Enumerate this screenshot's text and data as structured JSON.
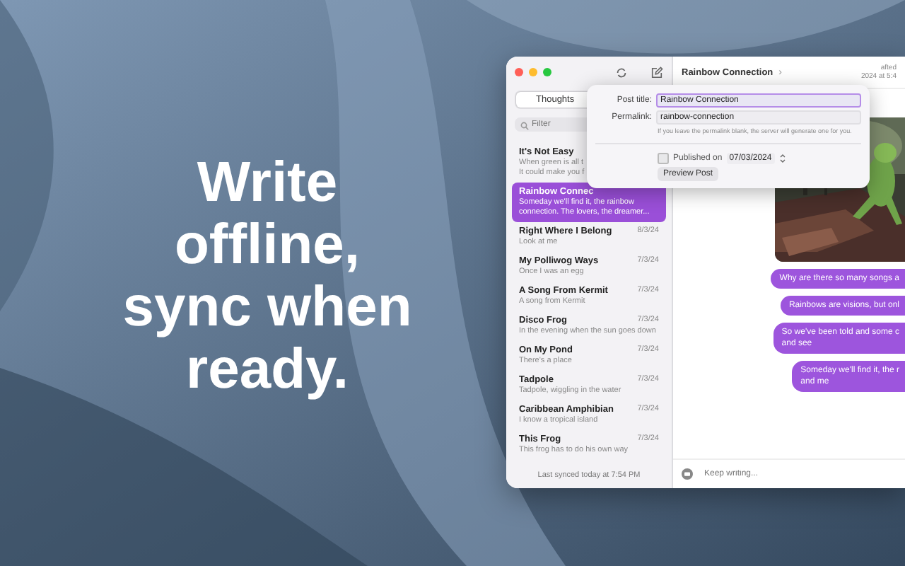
{
  "headline": "Write\noffline,\nsync when\nready.",
  "sidebar": {
    "tabs": [
      {
        "label": "Thoughts",
        "selected": true
      }
    ],
    "search": {
      "placeholder": "Filter"
    },
    "items": [
      {
        "title": "It's Not Easy",
        "preview": "When green is all t\nIt could make you f",
        "selected": false
      },
      {
        "title": "Rainbow Connec",
        "preview": "Someday we'll find it, the rainbow connection. The lovers, the dreamer...",
        "selected": true
      },
      {
        "title": "Right Where I Belong",
        "preview": "Look at me",
        "date": "8/3/24",
        "selected": false
      },
      {
        "title": "My Polliwog Ways",
        "preview": "Once I was an egg",
        "date": "7/3/24",
        "selected": false
      },
      {
        "title": "A Song From Kermit",
        "preview": "A song from Kermit",
        "date": "7/3/24",
        "selected": false
      },
      {
        "title": "Disco Frog",
        "preview": "In the evening when the sun goes down",
        "date": "7/3/24",
        "selected": false
      },
      {
        "title": "On My Pond",
        "preview": "There's a place",
        "date": "7/3/24",
        "selected": false
      },
      {
        "title": "Tadpole",
        "preview": "Tadpole, wiggling in the water",
        "date": "7/3/24",
        "selected": false
      },
      {
        "title": "Caribbean Amphibian",
        "preview": "I know a tropical island",
        "date": "7/3/24",
        "selected": false
      },
      {
        "title": "This Frog",
        "preview": "This frog has to do his own way",
        "date": "7/3/24",
        "selected": false
      }
    ],
    "footer": "Last synced today at 7:54 PM"
  },
  "editor": {
    "title": "Rainbow Connection",
    "chevron": "›",
    "meta": [
      "afted",
      "2024 at 5:4"
    ],
    "messages": [
      {
        "kind": "picture"
      },
      {
        "kind": "text",
        "text": "Why are there so many songs a"
      },
      {
        "kind": "text",
        "text": "Rainbows are visions, but onl"
      },
      {
        "kind": "text",
        "text": "So we've been told and some c\nand see"
      },
      {
        "kind": "text",
        "text": "Someday we'll find it, the r\nand me"
      }
    ],
    "composer": {
      "placeholder": "Keep writing..."
    }
  },
  "popover": {
    "post_title": {
      "label": "Post title:",
      "value": "Rainbow Connection"
    },
    "permalink": {
      "label": "Permalink:",
      "value": "rainbow-connection",
      "hint": "If you leave the permalink blank, the server will generate one for you."
    },
    "published": {
      "label": "Published on",
      "checked": false,
      "date": "07/03/2024"
    },
    "button": "Preview Post"
  }
}
